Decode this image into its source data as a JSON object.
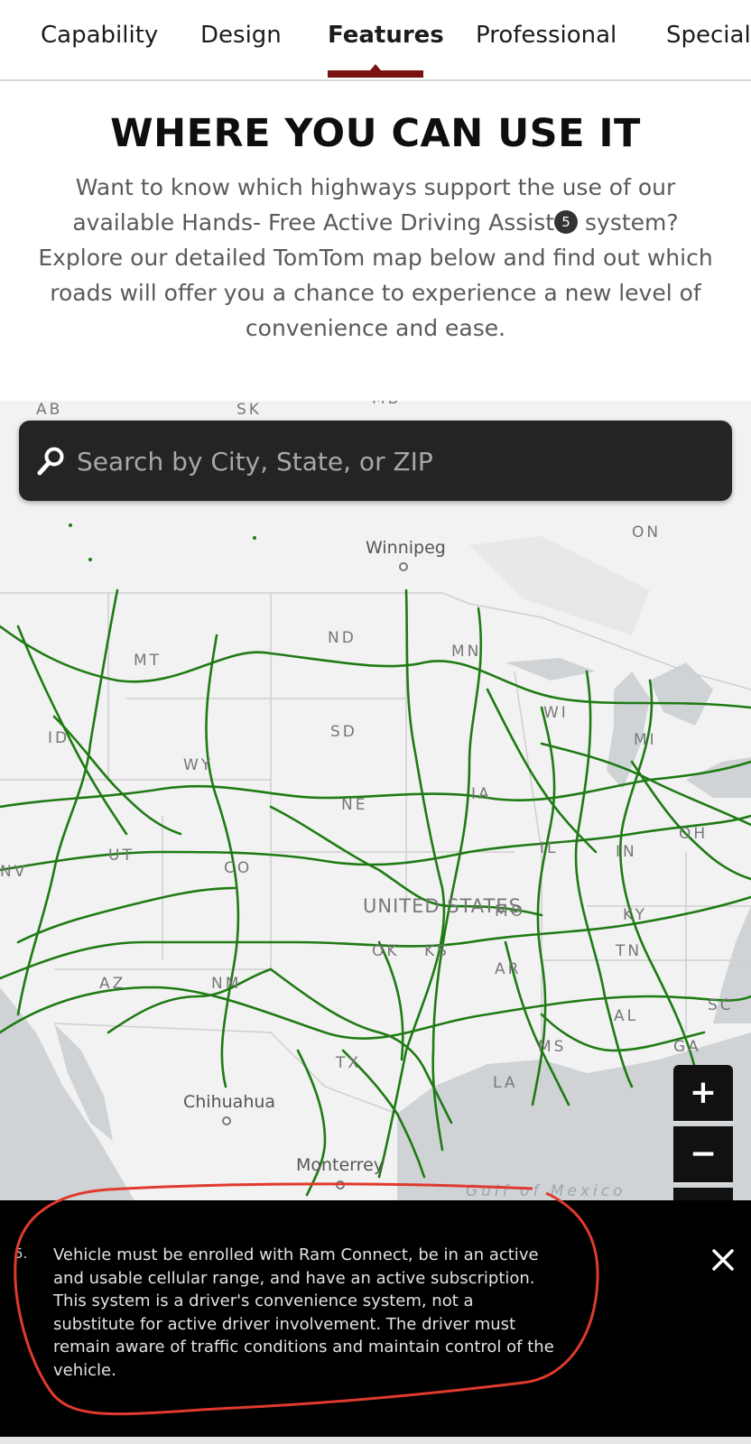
{
  "tabs": [
    {
      "label": "Capability",
      "active": false
    },
    {
      "label": "Design",
      "active": false
    },
    {
      "label": "Features",
      "active": true
    },
    {
      "label": "Professional",
      "active": false
    },
    {
      "label": "Special",
      "active": false
    }
  ],
  "section": {
    "title": "WHERE YOU CAN USE IT",
    "intro_before": "Want to know which highways support the use of our available Hands- Free Active Driving Assist",
    "footnote_ref": "5",
    "intro_after": " system? Explore our detailed TomTom map below and find out which roads will offer you a chance to experience a new level of convenience and ease."
  },
  "search": {
    "placeholder": "Search by City, State, or ZIP",
    "icon": "search-icon"
  },
  "map": {
    "country_label": "UNITED STATES",
    "water_label": "Gulf of Mexico",
    "city_labels": {
      "winnipeg": "Winnipeg",
      "chihuahua": "Chihuahua",
      "monterrey": "Monterrey"
    },
    "region_labels": {
      "ab": "AB",
      "sk": "SK",
      "mb": "MB",
      "on": "ON",
      "mt": "MT",
      "nd": "ND",
      "mn": "MN",
      "id": "ID",
      "sd": "SD",
      "wi": "WI",
      "mi": "MI",
      "wy": "WY",
      "ne": "NE",
      "ia": "IA",
      "nv": "NV",
      "ut": "UT",
      "co": "CO",
      "il": "IL",
      "in": "IN",
      "oh": "OH",
      "ks": "KS",
      "mo": "MO",
      "ky": "KY",
      "ok": "OK",
      "tn": "TN",
      "az": "AZ",
      "nm": "NM",
      "ar": "AR",
      "sc": "SC",
      "ms": "MS",
      "al": "AL",
      "ga": "GA",
      "tx": "TX",
      "la": "LA"
    },
    "highway_color": "#1f7a14",
    "zoom_in_label": "+",
    "zoom_out_label": "−"
  },
  "footnote": {
    "number": "5.",
    "text": "Vehicle must be enrolled with Ram Connect, be in an active and usable cellular range, and have an active subscription. This system is a driver's convenience system, not a substitute for active driver involvement. The driver must remain aware of traffic conditions and maintain control of the vehicle.",
    "close_icon": "close-icon"
  },
  "colors": {
    "accent": "#7a1212",
    "annotation": "#e03a2f"
  }
}
